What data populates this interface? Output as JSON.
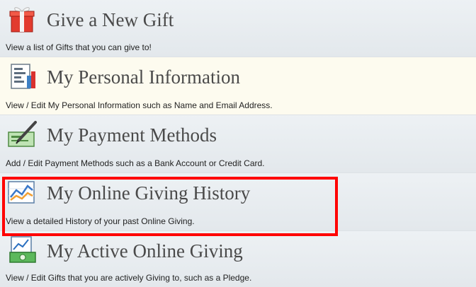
{
  "menu": {
    "items": [
      {
        "icon": "gift-icon",
        "title": "Give a New Gift",
        "description": "View a list of Gifts that you can give to!"
      },
      {
        "icon": "personal-info-icon",
        "title": "My Personal Information",
        "description": "View / Edit My Personal Information such as Name and Email Address."
      },
      {
        "icon": "payment-methods-icon",
        "title": "My Payment Methods",
        "description": "Add / Edit Payment Methods such as a Bank Account or Credit Card."
      },
      {
        "icon": "history-chart-icon",
        "title": "My Online Giving History",
        "description": "View a detailed History of your past Online Giving."
      },
      {
        "icon": "active-giving-icon",
        "title": "My Active Online Giving",
        "description": "View / Edit Gifts that you are actively Giving to, such as a Pledge."
      }
    ]
  },
  "colors": {
    "highlight_border": "#ff0000",
    "row_gray": "#e8ecef",
    "row_cream": "#fdfbef",
    "title_text": "#4a4a4a"
  }
}
